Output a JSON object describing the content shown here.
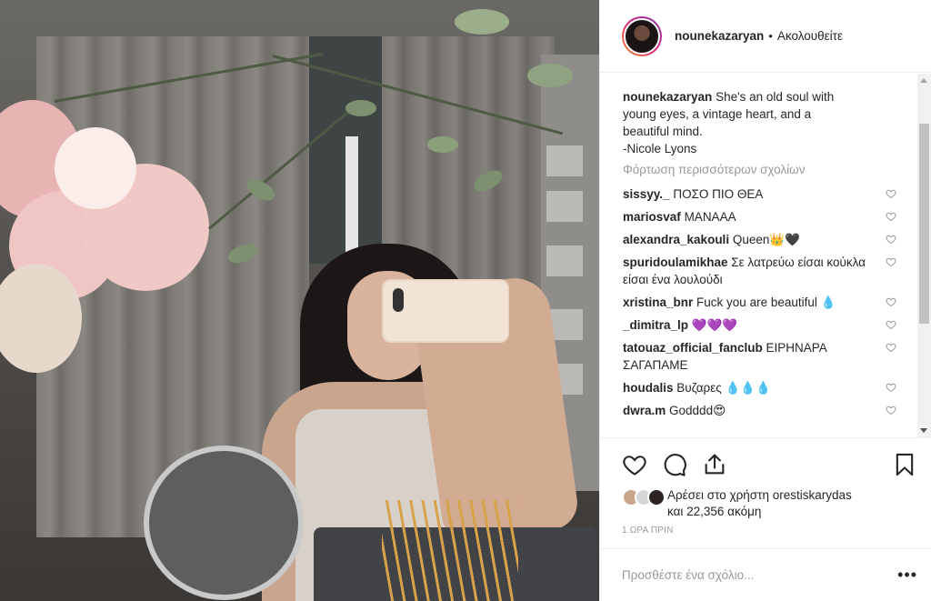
{
  "header": {
    "username": "nounekazaryan",
    "separator": "•",
    "follow_state": "Ακολουθείτε"
  },
  "caption": {
    "username": "nounekazaryan",
    "lines": [
      "She's an old soul with",
      "young eyes, a vintage heart, and a",
      "beautiful mind.",
      "-Nicole Lyons"
    ]
  },
  "load_more": "Φόρτωση περισσότερων σχολίων",
  "comments": [
    {
      "user": "sissyy._",
      "text": "ΠΟΣΟ ΠΙΟ ΘΕΑ"
    },
    {
      "user": "mariosvaf",
      "text": "ΜΑΝΑΑΑ"
    },
    {
      "user": "alexandra_kakouli",
      "text": "Queen👑🖤"
    },
    {
      "user": "spuridoulamikhae",
      "text": "Σε λατρεύω είσαι κούκλα είσαι ένα λουλούδι"
    },
    {
      "user": "xristina_bnr",
      "text": "Fuck you are beautiful 💧"
    },
    {
      "user": "_dimitra_lp",
      "text": "💜💜💜"
    },
    {
      "user": "tatouaz_official_fanclub",
      "text": "ΕΙΡΗΝΑΡΑ ΣΑΓΑΠΑΜΕ"
    },
    {
      "user": "houdalis",
      "text": "Βυζαρες 💧💧💧"
    },
    {
      "user": "dwra.m",
      "text": "Godddd😍"
    }
  ],
  "likes": {
    "prefix": "Αρέσει στο χρήστη",
    "user": "orestiskarydas",
    "suffix": "και 22,356 ακόμη"
  },
  "time_ago": "1 ΩΡΑ ΠΡΙΝ",
  "add_comment_placeholder": "Προσθέστε ένα σχόλιο...",
  "more_label": "•••",
  "icons": {
    "like": "heart-icon",
    "comment": "comment-icon",
    "share": "share-icon",
    "save": "bookmark-icon"
  },
  "colors": {
    "text": "#262626",
    "muted": "#999999",
    "border": "#efefef",
    "avatar_ring_start": "#f58529",
    "avatar_ring_end": "#8134af"
  }
}
